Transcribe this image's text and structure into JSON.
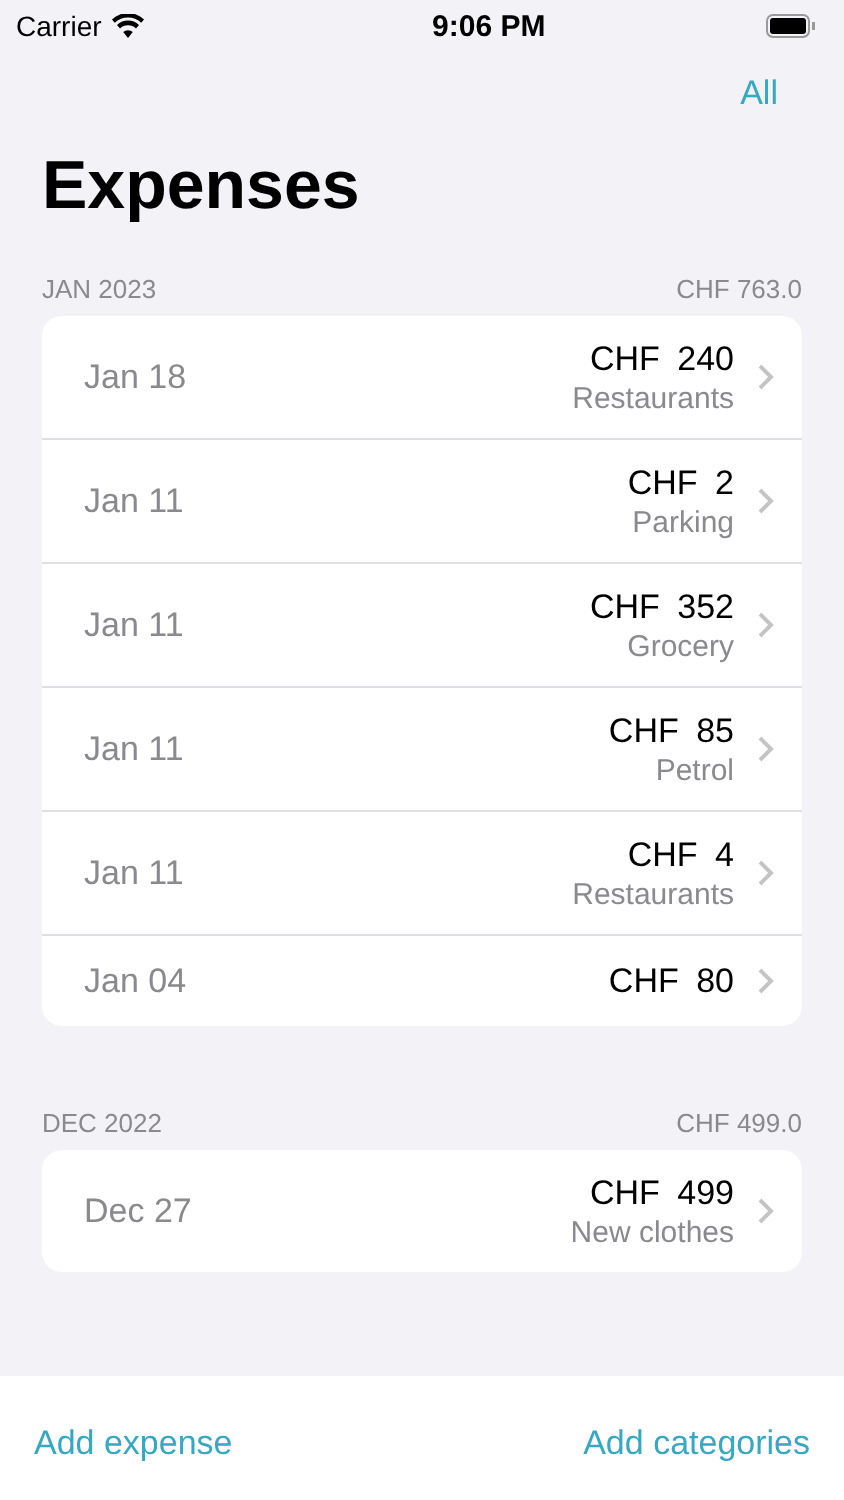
{
  "status_bar": {
    "carrier": "Carrier",
    "time": "9:06 PM"
  },
  "nav": {
    "filter_button": "All",
    "title": "Expenses"
  },
  "sections": [
    {
      "header": "JAN 2023",
      "total": "CHF 763.0",
      "rows": [
        {
          "date": "Jan 18",
          "amount": "CHF 240",
          "category": "Restaurants"
        },
        {
          "date": "Jan 11",
          "amount": "CHF 2",
          "category": "Parking"
        },
        {
          "date": "Jan 11",
          "amount": "CHF 352",
          "category": "Grocery"
        },
        {
          "date": "Jan 11",
          "amount": "CHF 85",
          "category": "Petrol"
        },
        {
          "date": "Jan 11",
          "amount": "CHF 4",
          "category": "Restaurants"
        },
        {
          "date": "Jan 04",
          "amount": "CHF 80"
        }
      ]
    },
    {
      "header": "DEC 2022",
      "total": "CHF 499.0",
      "rows": [
        {
          "date": "Dec 27",
          "amount": "CHF 499",
          "category": "New clothes"
        }
      ]
    }
  ],
  "toolbar": {
    "left": "Add expense",
    "right": "Add categories"
  }
}
